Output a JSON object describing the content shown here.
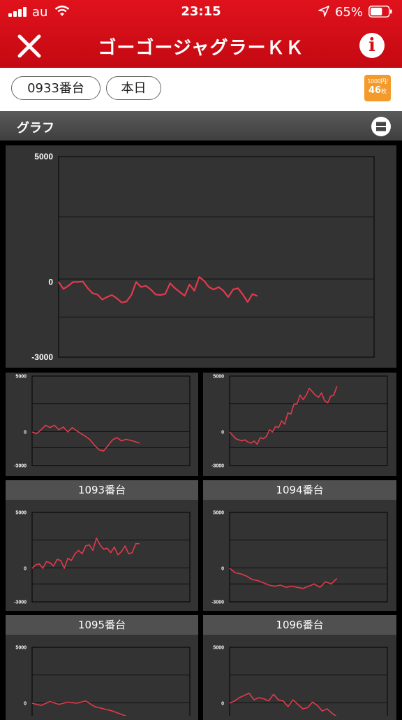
{
  "status_bar": {
    "carrier": "au",
    "time": "23:15",
    "battery": "65%",
    "battery_level": 0.65
  },
  "title_bar": {
    "title": "ゴーゴージャグラーＫＫ",
    "close_icon": "close-icon",
    "info_icon": "info-icon",
    "info_glyph": "i"
  },
  "filters": {
    "machine": "0933番台",
    "day": "本日",
    "rate_line1": "1000円/",
    "rate_line2": "46",
    "rate_unit": "枚"
  },
  "section": {
    "title": "グラフ",
    "toggle_icon": "layout-toggle-icon"
  },
  "colors": {
    "accent": "#d40d16",
    "line": "#e23a4c",
    "panel": "#333333",
    "rate_badge": "#f39a2b"
  },
  "chart_data": [
    {
      "type": "line",
      "ylim": [
        -3000,
        5000
      ],
      "yticks": [
        "5000",
        "0",
        "-3000"
      ],
      "values": [
        0,
        -280,
        -150,
        0,
        0,
        20,
        -250,
        -450,
        -500,
        -700,
        -600,
        -520,
        -650,
        -820,
        -780,
        -520,
        0,
        -200,
        -150,
        -300,
        -500,
        -520,
        -480,
        -50,
        -250,
        -400,
        -550,
        -100,
        -350,
        200,
        50,
        -200,
        -300,
        -200,
        -350,
        -600,
        -300,
        -250,
        -500,
        -800,
        -480,
        -560
      ]
    },
    {
      "type": "line",
      "ylim": [
        -3000,
        5000
      ],
      "yticks": [
        "5000",
        "0",
        "-3000"
      ],
      "values": [
        0,
        -150,
        200,
        600,
        400,
        600,
        200,
        450,
        0,
        400,
        100,
        -150,
        -400,
        -700,
        -1200,
        -1600,
        -1700,
        -1200,
        -700,
        -500,
        -800,
        -650,
        -750,
        -850,
        -1000
      ]
    },
    {
      "type": "line",
      "ylim": [
        -3000,
        5000
      ],
      "yticks": [
        "5000",
        "0",
        "-3000"
      ],
      "values": [
        0,
        -300,
        -600,
        -700,
        -800,
        -700,
        -900,
        -1000,
        -800,
        -1100,
        -500,
        -600,
        -400,
        200,
        0,
        500,
        400,
        1000,
        700,
        1700,
        1600,
        2500,
        2500,
        3300,
        2900,
        3300,
        3900,
        3600,
        3300,
        3100,
        3500,
        2800,
        2600,
        3200,
        3300,
        4100
      ]
    },
    {
      "name": "1093番台",
      "type": "line",
      "ylim": [
        -3000,
        5000
      ],
      "yticks": [
        "5000",
        "0",
        "-3000"
      ],
      "values": [
        0,
        300,
        400,
        0,
        600,
        500,
        200,
        800,
        700,
        0,
        900,
        700,
        1300,
        1600,
        1300,
        2000,
        2100,
        1600,
        2700,
        2100,
        1700,
        1800,
        1400,
        1900,
        1200,
        1500,
        2000,
        1300,
        1400,
        2200,
        2200
      ]
    },
    {
      "name": "1094番台",
      "type": "line",
      "ylim": [
        -3000,
        5000
      ],
      "yticks": [
        "5000",
        "0",
        "-3000"
      ],
      "values": [
        0,
        -400,
        -500,
        -700,
        -1000,
        -1100,
        -1300,
        -1500,
        -1600,
        -1500,
        -1700,
        -1600,
        -1700,
        -1800,
        -1600,
        -1400,
        -1700,
        -1200,
        -1400,
        -900
      ]
    },
    {
      "name": "1095番台",
      "type": "line",
      "ylim": [
        -3000,
        5000
      ],
      "yticks": [
        "5000",
        "0",
        "-3000"
      ],
      "values": [
        0,
        -200,
        150,
        -100,
        100,
        0,
        200,
        -300,
        -500,
        -700,
        -1000,
        -1300,
        -1600
      ]
    },
    {
      "name": "1096番台",
      "type": "line",
      "ylim": [
        -3000,
        5000
      ],
      "yticks": [
        "5000",
        "0",
        "-3000"
      ],
      "values": [
        0,
        200,
        500,
        700,
        900,
        300,
        500,
        400,
        200,
        800,
        300,
        200,
        -300,
        300,
        -100,
        -500,
        -400,
        100,
        -200,
        -700,
        -500,
        -900,
        -1200
      ]
    }
  ]
}
